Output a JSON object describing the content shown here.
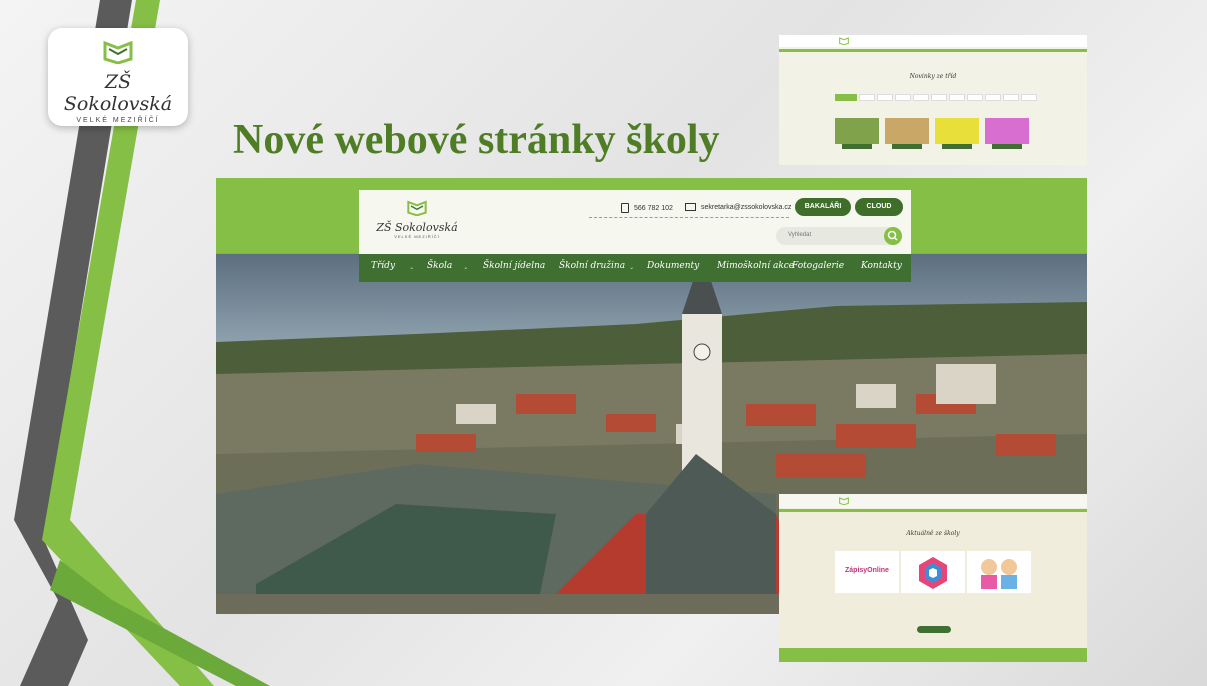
{
  "slide": {
    "title": "Nové webové stránky školy",
    "logo_name": "ZŠ Sokolovská",
    "logo_sub": "VELKÉ MEZIŘÍČÍ"
  },
  "website": {
    "logo_name": "ZŠ Sokolovská",
    "logo_sub": "VELKÉ MEZIŘÍČÍ",
    "phone": "566 782 102",
    "email": "sekretarka@zssokolovska.cz",
    "buttons": [
      "BAKALÁŘI",
      "CLOUD"
    ],
    "search_placeholder": "Vyhledat",
    "nav": [
      "Třídy",
      "Škola",
      "Školní jídelna",
      "Školní družina",
      "Dokumenty",
      "Mimoškolní akce",
      "Fotogalerie",
      "Kontakty"
    ]
  },
  "preview_top": {
    "heading": "Novinky ze tříd"
  },
  "preview_bottom": {
    "heading": "Aktuálně ze školy",
    "card_label": "ZápisyOnline"
  },
  "colors": {
    "brand_green": "#86bf45",
    "dark_green": "#3f7031",
    "title_green": "#4e7d26"
  }
}
